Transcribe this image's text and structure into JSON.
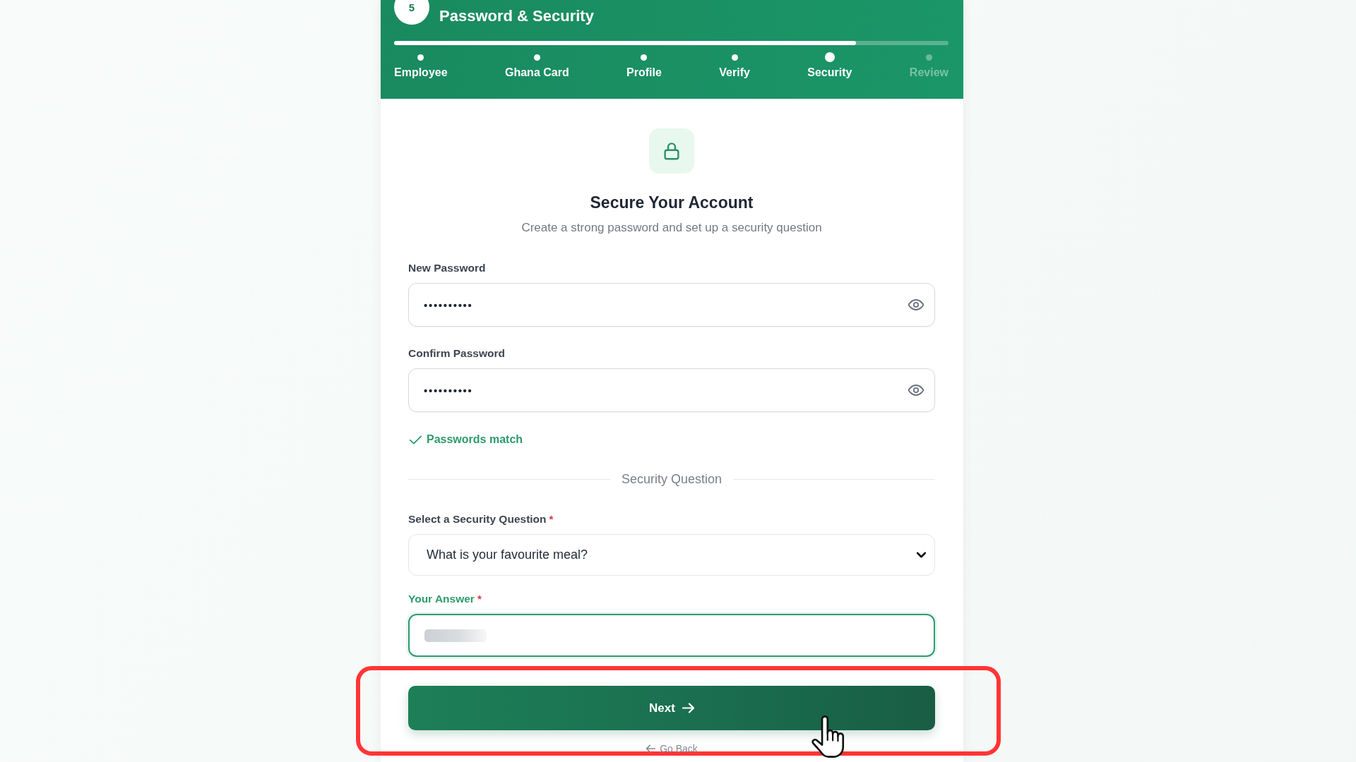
{
  "header": {
    "step_number": "5",
    "title": "Password & Security",
    "progress": {
      "level": 0.833
    }
  },
  "steps": [
    {
      "label": "Employee",
      "completed": true,
      "selected": false
    },
    {
      "label": "Ghana Card",
      "completed": true,
      "selected": false
    },
    {
      "label": "Profile",
      "completed": true,
      "selected": false
    },
    {
      "label": "Verify",
      "completed": true,
      "selected": false
    },
    {
      "label": "Security",
      "completed": false,
      "selected": true
    },
    {
      "label": "Review",
      "completed": false,
      "selected": false
    }
  ],
  "intro": {
    "title": "Secure Your Account",
    "subtitle": "Create a strong password and set up a security question"
  },
  "form": [
    {
      "kind": "password",
      "label": "New Password",
      "value": "••••••••••"
    },
    {
      "kind": "password",
      "label": "Confirm Password",
      "value": "••••••••••"
    },
    {
      "kind": "match",
      "text": "Passwords match",
      "matched": true
    },
    {
      "kind": "divider",
      "text": "Security Question"
    },
    {
      "kind": "select",
      "label": "Select a Security Question",
      "required_mark": "*",
      "value": "What is your favourite meal?"
    },
    {
      "kind": "text",
      "label": "Your Answer",
      "required_mark": "*",
      "focused": true,
      "value_blurred": true
    }
  ],
  "actions": {
    "highlighted": true,
    "next": {
      "label": "Next",
      "hovered": true
    },
    "back": {
      "label": "Go Back"
    }
  }
}
